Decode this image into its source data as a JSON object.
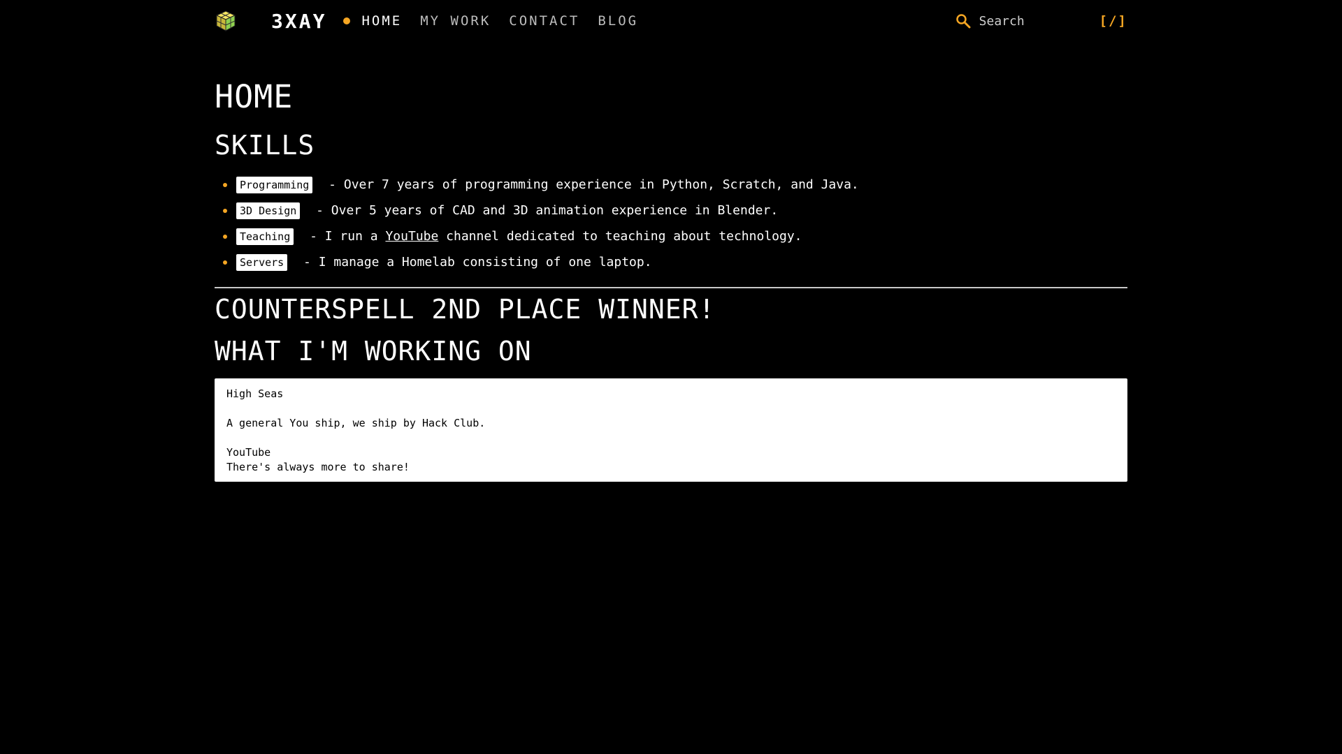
{
  "header": {
    "logo_icon": "cube-logo-icon",
    "brand": "3XAY",
    "nav": [
      {
        "label": "HOME",
        "active": true
      },
      {
        "label": "MY WORK",
        "active": false
      },
      {
        "label": "CONTACT",
        "active": false
      },
      {
        "label": "BLOG",
        "active": false
      }
    ],
    "search_placeholder": "Search",
    "search_icon": "search-icon",
    "shortcut": "[/]"
  },
  "main": {
    "title": "HOME",
    "skills_title": "SKILLS",
    "skills": [
      {
        "tag": "Programming",
        "text": " - Over 7 years of programming experience in Python, Scratch, and Java."
      },
      {
        "tag": "3D Design",
        "text": " - Over 5 years of CAD and 3D animation experience in Blender."
      },
      {
        "tag": "Teaching",
        "text_before": " - I run a ",
        "link": "YouTube",
        "text_after": " channel dedicated to teaching about technology."
      },
      {
        "tag": "Servers",
        "text": " - I manage a Homelab consisting of one laptop."
      }
    ],
    "winner_title": "COUNTERSPELL 2ND PLACE WINNER!",
    "working_title": "WHAT I'M WORKING ON",
    "working_box": {
      "line1": "High Seas",
      "line2": "A general You ship, we ship by Hack Club.",
      "line3": "YouTube",
      "line4": "There's always more to share!"
    }
  },
  "colors": {
    "background": "#000000",
    "accent": "#f5a623",
    "text": "#ffffff"
  }
}
